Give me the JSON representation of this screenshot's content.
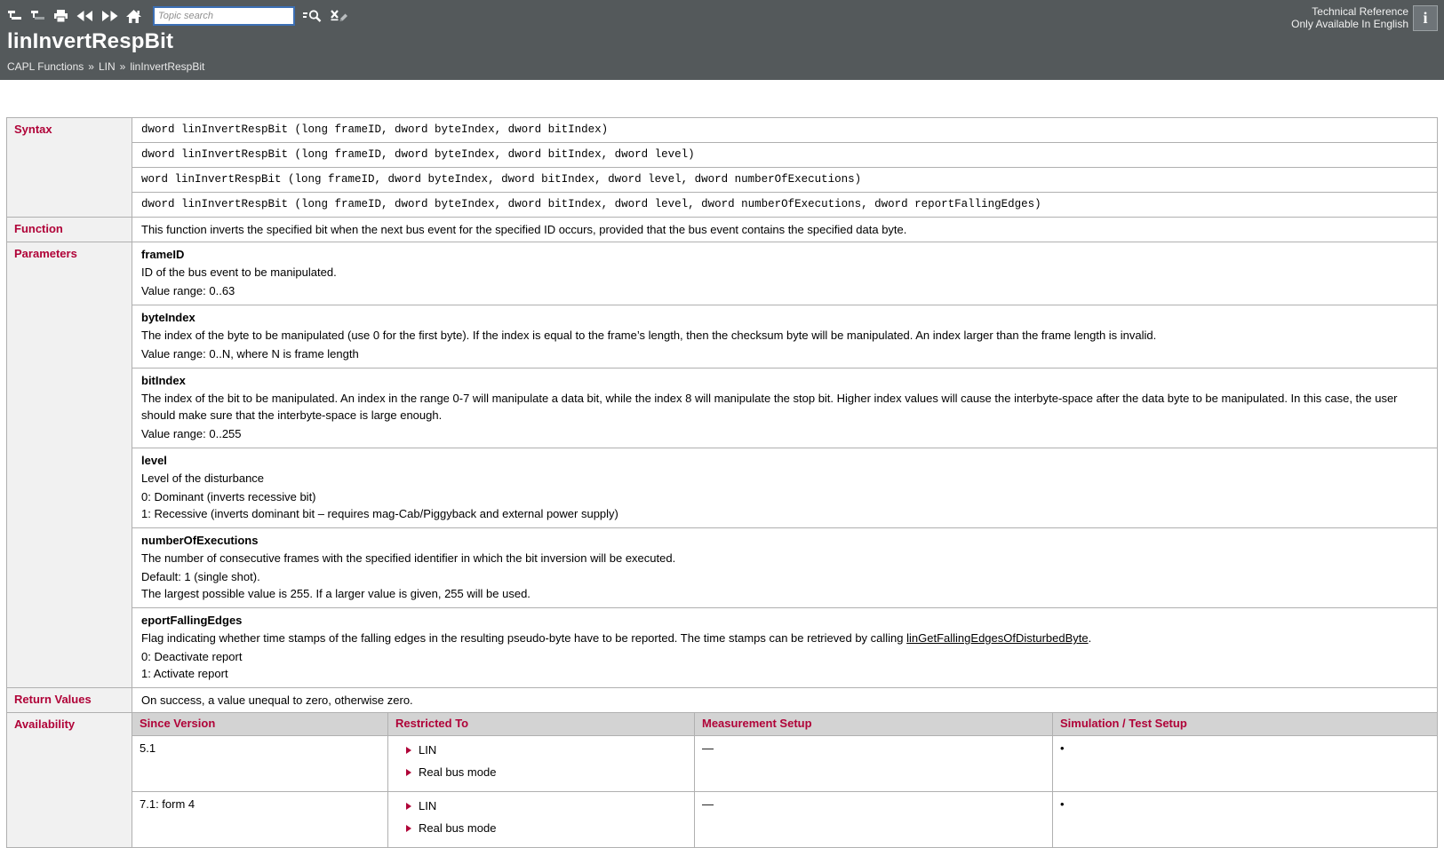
{
  "header": {
    "toolbar": {
      "search_placeholder": "Topic search",
      "icons": {
        "toc": "toc-tree-icon",
        "toc_sync": "toc-sync-icon",
        "print": "print-icon",
        "back": "back-icon",
        "forward": "forward-icon",
        "home": "home-icon",
        "search_go": "search-icon",
        "clear_highlight": "clear-highlights-icon"
      }
    },
    "meta": {
      "line1": "Technical Reference",
      "line2": "Only Available In English"
    },
    "info_glyph": "i",
    "title": "linInvertRespBit",
    "breadcrumb": {
      "items": [
        "CAPL Functions",
        "LIN",
        "linInvertRespBit"
      ],
      "separator": "»"
    }
  },
  "sections": {
    "syntax": {
      "label": "Syntax",
      "lines": [
        "dword linInvertRespBit (long frameID, dword byteIndex, dword bitIndex)",
        "dword linInvertRespBit (long frameID, dword byteIndex, dword bitIndex, dword level)",
        "word linInvertRespBit (long frameID, dword byteIndex, dword bitIndex, dword level, dword numberOfExecutions)",
        "dword linInvertRespBit (long frameID, dword byteIndex, dword bitIndex, dword level, dword numberOfExecutions, dword reportFallingEdges)"
      ]
    },
    "function": {
      "label": "Function",
      "text": "This function inverts the specified bit when the next bus event for the specified ID occurs, provided that the bus event contains the specified data byte."
    },
    "parameters": {
      "label": "Parameters",
      "items": {
        "frameID": {
          "name": "frameID",
          "desc": "ID of the bus event to be manipulated.",
          "range": "Value range: 0..63"
        },
        "byteIndex": {
          "name": "byteIndex",
          "desc": "The index of the byte to be manipulated (use 0 for the first byte). If the index is equal to the frame’s length, then the checksum byte will be manipulated. An index larger than the frame length is invalid.",
          "range": "Value range: 0..N, where N is frame length"
        },
        "bitIndex": {
          "name": "bitIndex",
          "desc": "The index of the bit to be manipulated. An index in the range 0-7 will manipulate a data bit, while the index 8 will manipulate the stop bit. Higher index values will cause the interbyte-space after the data byte to be manipulated. In this case, the user should make sure that the interbyte-space is large enough.",
          "range": "Value range: 0..255"
        },
        "level": {
          "name": "level",
          "desc": "Level of the disturbance",
          "option0": "0: Dominant (inverts recessive bit)",
          "option1": "1: Recessive (inverts dominant bit – requires mag-Cab/Piggyback and external power supply)"
        },
        "numberOfExecutions": {
          "name": "numberOfExecutions",
          "desc": "The number of consecutive frames with the specified identifier in which the bit inversion will be executed.",
          "note1": "Default: 1 (single shot).",
          "note2": "The largest possible value is 255. If a larger value is given, 255 will be used."
        },
        "reportFallingEdges": {
          "name": "eportFallingEdges",
          "desc_prefix": "Flag indicating whether time stamps of the falling edges in the resulting pseudo-byte have to be reported. The time stamps can be retrieved by calling ",
          "link": "linGetFallingEdgesOfDisturbedByte",
          "desc_suffix": ".",
          "option0": "0: Deactivate report",
          "option1": "1: Activate report"
        }
      }
    },
    "return_values": {
      "label": "Return Values",
      "text": "On success, a value unequal to zero, otherwise zero."
    },
    "availability": {
      "label": "Availability",
      "columns": [
        "Since Version",
        "Restricted To",
        "Measurement Setup",
        "Simulation / Test Setup"
      ],
      "rows": [
        {
          "since": "5.1",
          "restricted": [
            "LIN",
            "Real bus mode"
          ],
          "measurement": "—",
          "simulation": "•"
        },
        {
          "since": "7.1: form 4",
          "restricted": [
            "LIN",
            "Real bus mode"
          ],
          "measurement": "—",
          "simulation": "•"
        }
      ]
    }
  },
  "colors": {
    "accent": "#b00338",
    "header_bg": "#54595b",
    "table_border": "#b0b0b0",
    "label_bg": "#f1f1f1",
    "subheader_bg": "#d3d3d3",
    "search_border": "#3c6fb5"
  }
}
